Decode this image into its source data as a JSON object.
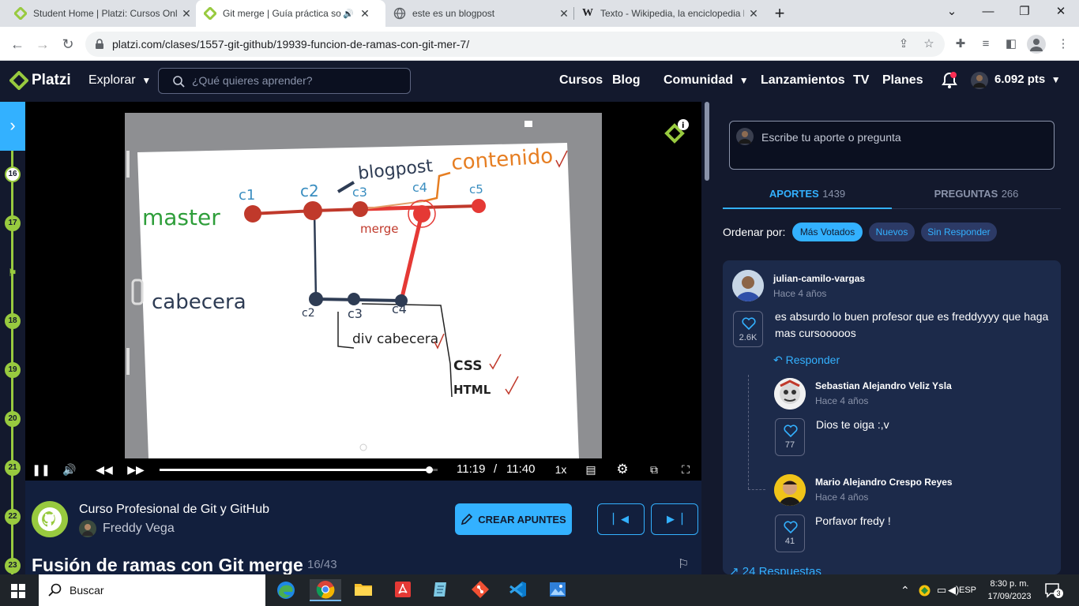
{
  "browser": {
    "tabs": [
      {
        "title": "Student Home | Platzi: Cursos Online",
        "icon": "platzi-logo-icon",
        "active": false
      },
      {
        "title": "Git merge | Guía práctica sobre Git",
        "icon": "platzi-logo-icon",
        "active": true
      },
      {
        "title": "este es un blogpost",
        "icon": "globe-icon",
        "active": false
      },
      {
        "title": "Texto - Wikipedia, la enciclopedia libre",
        "icon": "wikipedia-icon",
        "active": false
      }
    ],
    "url": "platzi.com/clases/1557-git-github/19939-funcion-de-ramas-con-git-mer-7/"
  },
  "header": {
    "logo": "Platzi",
    "explore": "Explorar",
    "search_placeholder": "¿Qué quieres aprender?",
    "nav": [
      "Cursos",
      "Blog",
      "Comunidad",
      "Lanzamientos",
      "TV",
      "Planes"
    ],
    "points": "6.092 pts"
  },
  "timeline": {
    "items": [
      "16",
      "17",
      "18",
      "19",
      "20",
      "21",
      "22",
      "23"
    ]
  },
  "video": {
    "current_time": "11:19",
    "separator": "/",
    "total_time": "11:40",
    "speed": "1x",
    "progress": 0.97,
    "whiteboard": {
      "branch_master": "master",
      "branch_cabecera": "cabecera",
      "commits_top": [
        "c1",
        "c2",
        "c3",
        "c4",
        "c5"
      ],
      "commits_bottom": [
        "c2",
        "c3",
        "c4"
      ],
      "blogpost": "blogpost",
      "contenido": "contenido",
      "merge": "merge",
      "div_cabecera": "div cabecera",
      "css": "CSS",
      "html": "HTML"
    }
  },
  "course": {
    "title": "Curso Profesional de Git y GitHub",
    "teacher": "Freddy Vega",
    "create_notes": "CREAR APUNTES",
    "lesson_title": "Fusión de ramas con Git merge",
    "lesson_index": "16/43"
  },
  "comments_panel": {
    "ask_placeholder": "Escribe tu aporte o pregunta",
    "tabs": [
      {
        "label": "APORTES",
        "count": "1439",
        "active": true
      },
      {
        "label": "PREGUNTAS",
        "count": "266",
        "active": false
      }
    ],
    "order_label": "Ordenar por:",
    "filters": [
      {
        "label": "Más Votados",
        "active": true
      },
      {
        "label": "Nuevos",
        "active": false
      },
      {
        "label": "Sin Responder",
        "active": false
      }
    ],
    "comment": {
      "author": "julian-camilo-vargas",
      "time": "Hace 4 años",
      "text": "es absurdo lo buen profesor que es freddyyyy que haga mas cursooooos",
      "likes": "2.6K",
      "reply_label": "Responder",
      "replies": [
        {
          "author": "Sebastian Alejandro Veliz Ysla",
          "time": "Hace 4 años",
          "text": "Dios te oiga :,v",
          "likes": "77"
        },
        {
          "author": "Mario Alejandro Crespo Reyes",
          "time": "Hace 4 años",
          "text": "Porfavor fredy !",
          "likes": "41"
        }
      ],
      "more_replies": "24 Respuestas"
    }
  },
  "taskbar": {
    "search_label": "Buscar",
    "language": "ESP",
    "time": "8:30 p. m.",
    "date": "17/09/2023",
    "notifications": "3"
  },
  "colors": {
    "platzi_green": "#98ca3f",
    "accent_blue": "#33b1ff",
    "header_bg": "#13192d"
  }
}
